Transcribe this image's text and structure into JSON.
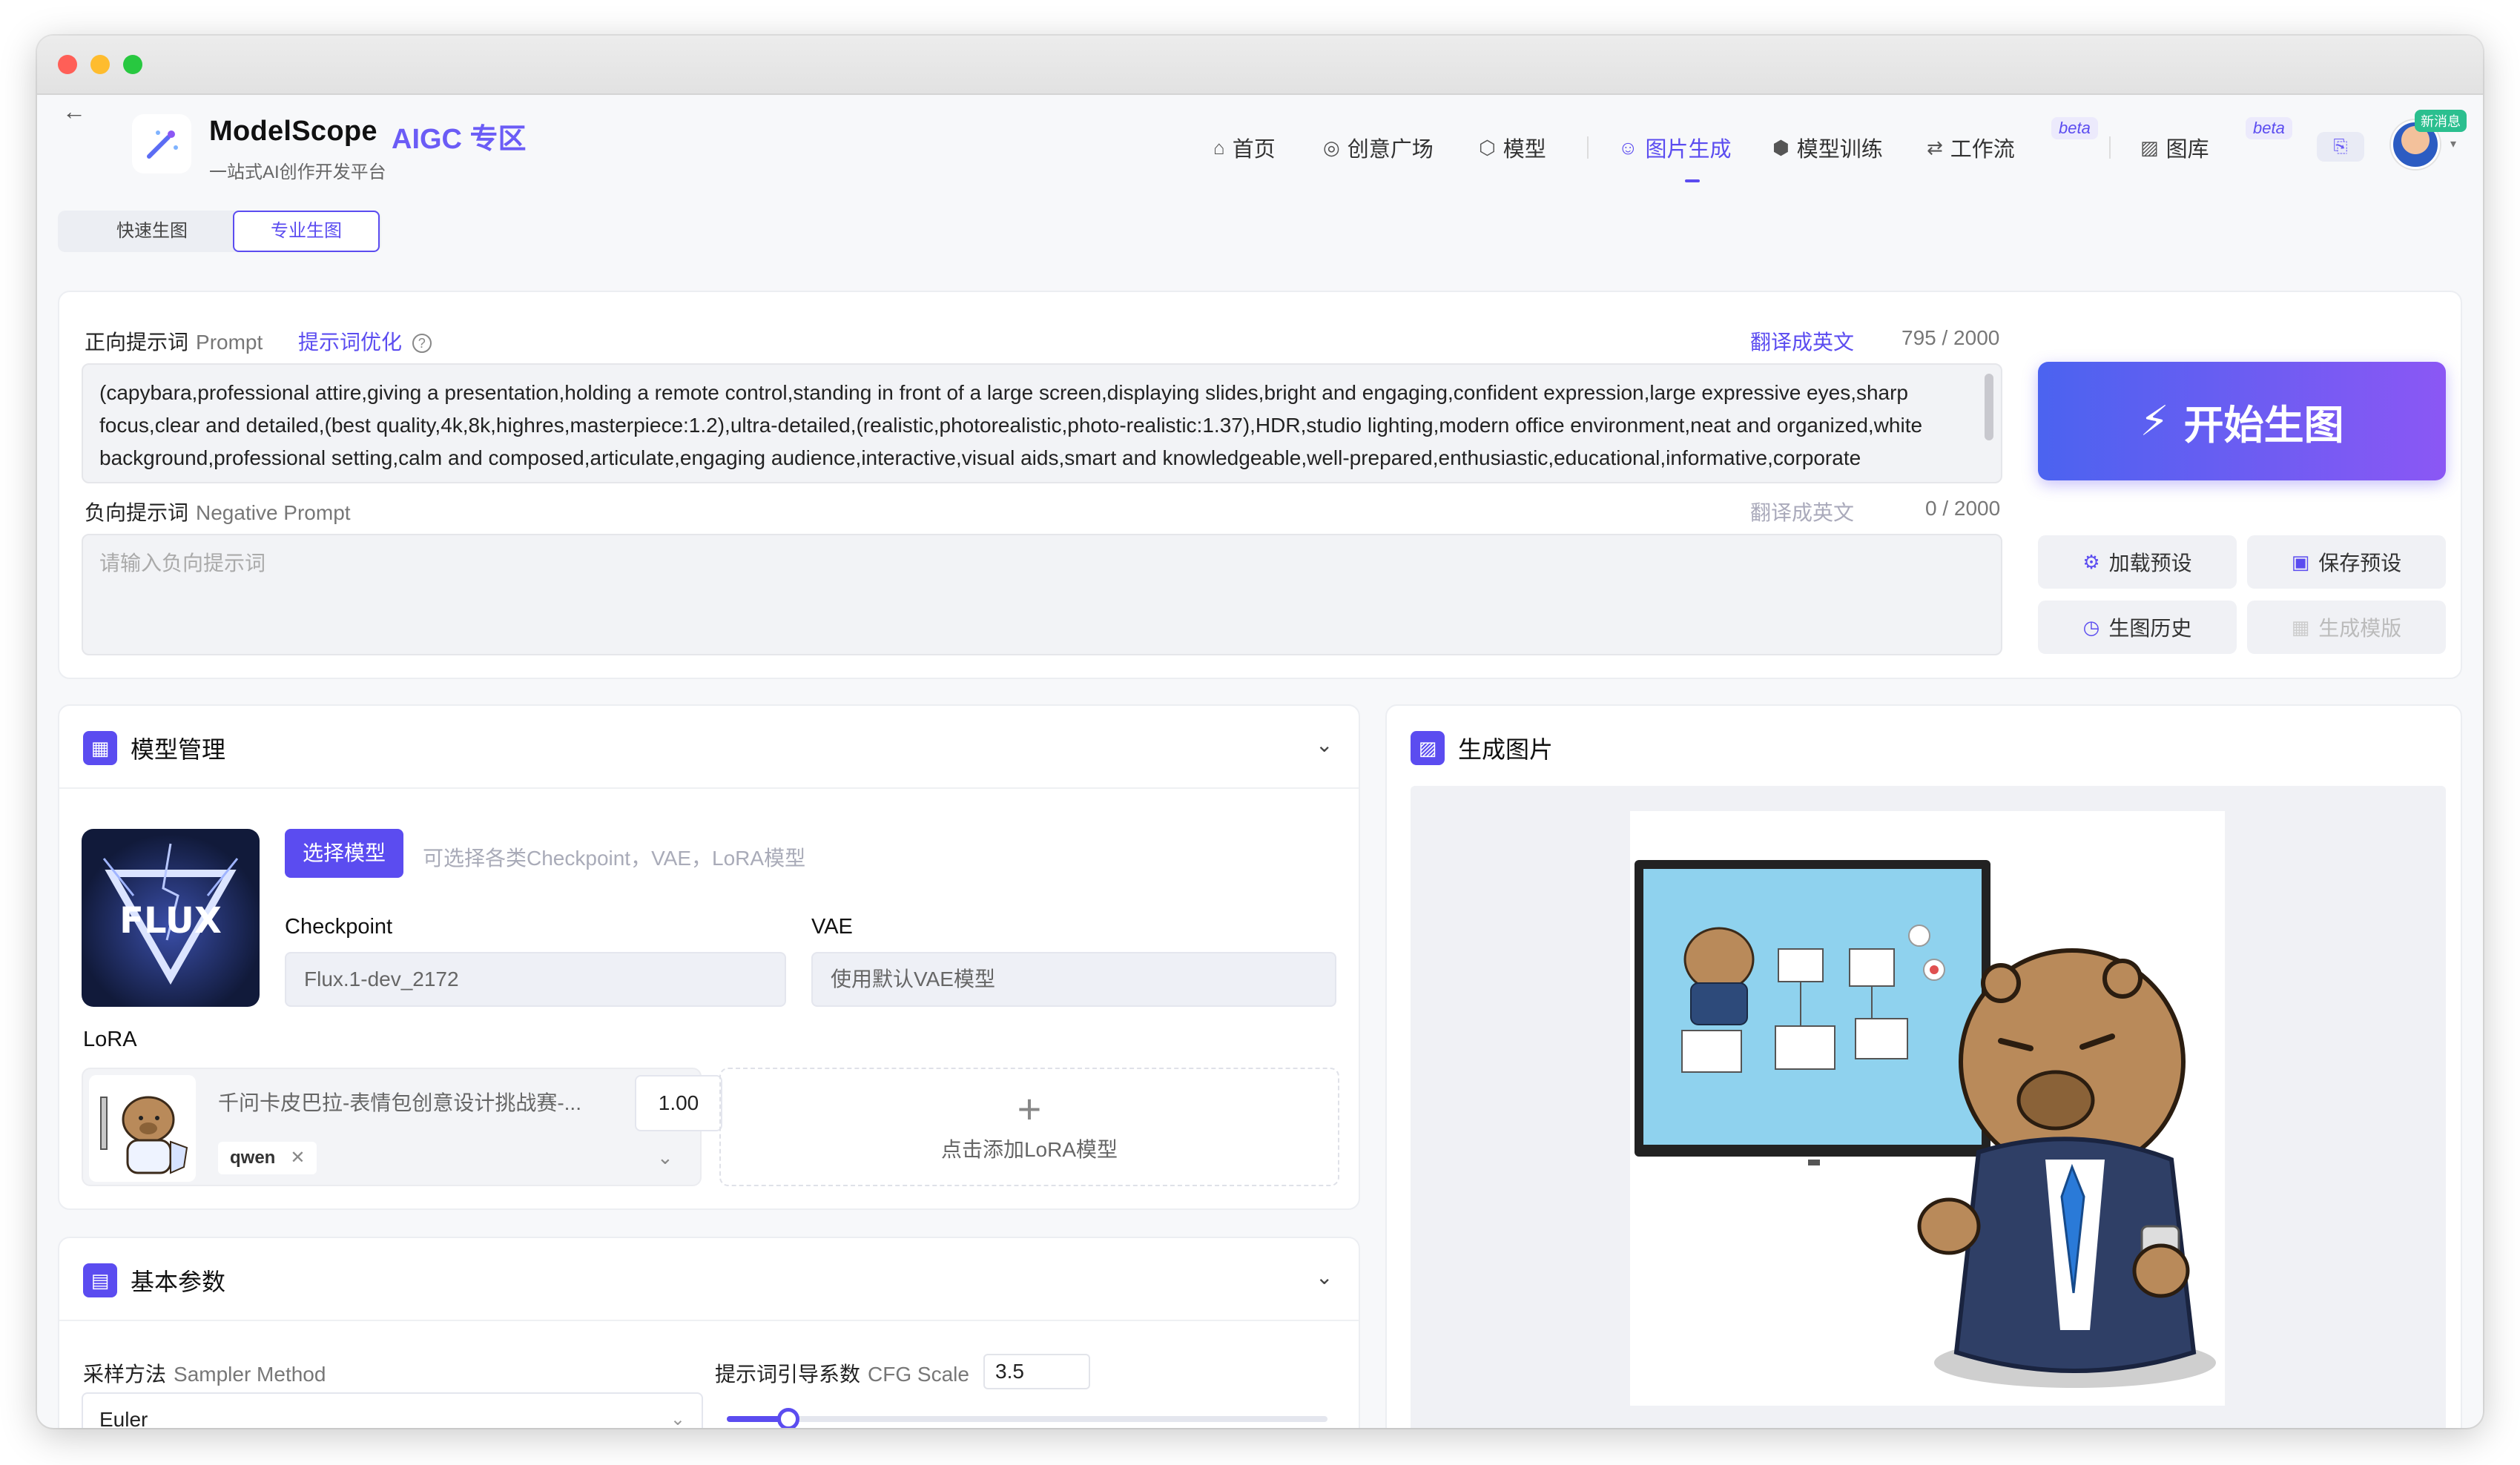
{
  "header": {
    "brand": "ModelScope",
    "brand_sub": "AIGC 专区",
    "tagline": "一站式AI创作开发平台"
  },
  "nav": {
    "items": [
      {
        "label": "首页",
        "icon": "home-icon"
      },
      {
        "label": "创意广场",
        "icon": "planet-icon"
      },
      {
        "label": "模型",
        "icon": "cube-icon"
      },
      {
        "label": "图片生成",
        "icon": "palette-icon"
      },
      {
        "label": "模型训练",
        "icon": "box-icon"
      },
      {
        "label": "工作流",
        "icon": "flow-icon"
      },
      {
        "label": "图库",
        "icon": "gallery-icon"
      }
    ],
    "beta_label": "beta",
    "avatar_badge": "新消息"
  },
  "mode": {
    "fast": "快速生图",
    "pro": "专业生图"
  },
  "prompt": {
    "label": "正向提示词",
    "label_en": "Prompt",
    "optimize": "提示词优化",
    "translate": "翻译成英文",
    "counter": "795 / 2000",
    "value": "(capybara,professional attire,giving a presentation,holding a remote control,standing in front of a large screen,displaying slides,bright and engaging,confident expression,large expressive eyes,sharp focus,clear and detailed,(best quality,4k,8k,highres,masterpiece:1.2),ultra-detailed,(realistic,photorealistic,photo-realistic:1.37),HDR,studio lighting,modern office environment,neat and organized,white background,professional setting,calm and composed,articulate,engaging audience,interactive,visual aids,smart and knowledgeable,well-prepared,enthusiastic,educational,informative,corporate style,modern design,crisp and clean,high contrast,sharp lines,professional photography,concept artists,office interior,corporate colors,blue and white tones,soft ambient lighting,professional"
  },
  "negative": {
    "label": "负向提示词",
    "label_en": "Negative Prompt",
    "translate": "翻译成英文",
    "counter": "0 / 2000",
    "placeholder": "请输入负向提示词"
  },
  "actions": {
    "generate": "开始生图",
    "load_preset": "加载预设",
    "save_preset": "保存预设",
    "history": "生图历史",
    "template": "生成模版"
  },
  "model": {
    "title": "模型管理",
    "select": "选择模型",
    "hint": "可选择各类Checkpoint，VAE，LoRA模型",
    "thumb_text": "FLUX",
    "checkpoint_label": "Checkpoint",
    "checkpoint_value": "Flux.1-dev_2172",
    "vae_label": "VAE",
    "vae_value": "使用默认VAE模型",
    "lora_label": "LoRA",
    "lora_name": "千问卡皮巴拉-表情包创意设计挑战赛-...",
    "lora_weight": "1.00",
    "lora_tag": "qwen",
    "add_lora": "点击添加LoRA模型"
  },
  "output": {
    "title": "生成图片"
  },
  "basic": {
    "title": "基本参数",
    "sampler_label": "采样方法",
    "sampler_label_en": "Sampler Method",
    "sampler_value": "Euler",
    "cfg_label": "提示词引导系数",
    "cfg_label_en": "CFG Scale",
    "cfg_value": "3.5"
  }
}
